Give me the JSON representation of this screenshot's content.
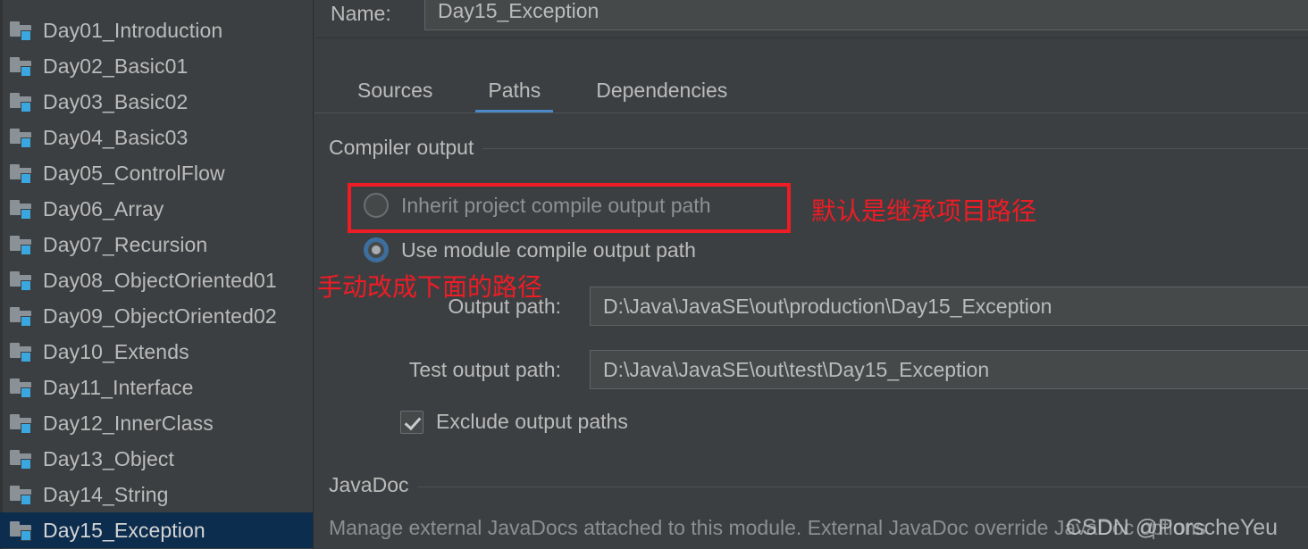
{
  "sidebar": {
    "modules": [
      {
        "label": "Day01_Introduction",
        "icon": "module-folder-icon",
        "selected": false
      },
      {
        "label": "Day02_Basic01",
        "icon": "module-folder-icon",
        "selected": false
      },
      {
        "label": "Day03_Basic02",
        "icon": "module-folder-icon",
        "selected": false
      },
      {
        "label": "Day04_Basic03",
        "icon": "module-folder-icon",
        "selected": false
      },
      {
        "label": "Day05_ControlFlow",
        "icon": "module-folder-icon",
        "selected": false
      },
      {
        "label": "Day06_Array",
        "icon": "module-folder-icon",
        "selected": false
      },
      {
        "label": "Day07_Recursion",
        "icon": "module-folder-icon",
        "selected": false
      },
      {
        "label": "Day08_ObjectOriented01",
        "icon": "module-folder-icon",
        "selected": false
      },
      {
        "label": "Day09_ObjectOriented02",
        "icon": "module-folder-icon",
        "selected": false
      },
      {
        "label": "Day10_Extends",
        "icon": "module-folder-icon",
        "selected": false
      },
      {
        "label": "Day11_Interface",
        "icon": "module-folder-icon",
        "selected": false
      },
      {
        "label": "Day12_InnerClass",
        "icon": "module-folder-icon",
        "selected": false
      },
      {
        "label": "Day13_Object",
        "icon": "module-folder-icon",
        "selected": false
      },
      {
        "label": "Day14_String",
        "icon": "module-folder-icon",
        "selected": false
      },
      {
        "label": "Day15_Exception",
        "icon": "module-folder-icon",
        "selected": true
      }
    ],
    "selection_color": "#0d2d4e",
    "badge_color": "#3aa7e0"
  },
  "module": {
    "name_label": "Name:",
    "name_value": "Day15_Exception"
  },
  "tabs": [
    {
      "label": "Sources",
      "active": false
    },
    {
      "label": "Paths",
      "active": true
    },
    {
      "label": "Dependencies",
      "active": false
    }
  ],
  "tab_accent_color": "#4a88c7",
  "compiler_output": {
    "group_title": "Compiler output",
    "inherit_option": "Inherit project compile output path",
    "module_option": "Use module compile output path",
    "selected_option": "Use module compile output path",
    "output_path_label": "Output path:",
    "output_path_value": "D:\\Java\\JavaSE\\out\\production\\Day15_Exception",
    "test_output_path_label": "Test output path:",
    "test_output_path_value": "D:\\Java\\JavaSE\\out\\test\\Day15_Exception",
    "exclude_label": "Exclude output paths",
    "exclude_checked": true
  },
  "javadoc": {
    "group_title": "JavaDoc",
    "description": "Manage external JavaDocs attached to this module. External JavaDoc override JavaDoc options"
  },
  "annotations": {
    "color": "#ee1c25",
    "inherit_note": "默认是继承项目路径",
    "manual_note": "手动改成下面的路径"
  },
  "watermark": {
    "text": "CSDN @PorscheYeu"
  }
}
